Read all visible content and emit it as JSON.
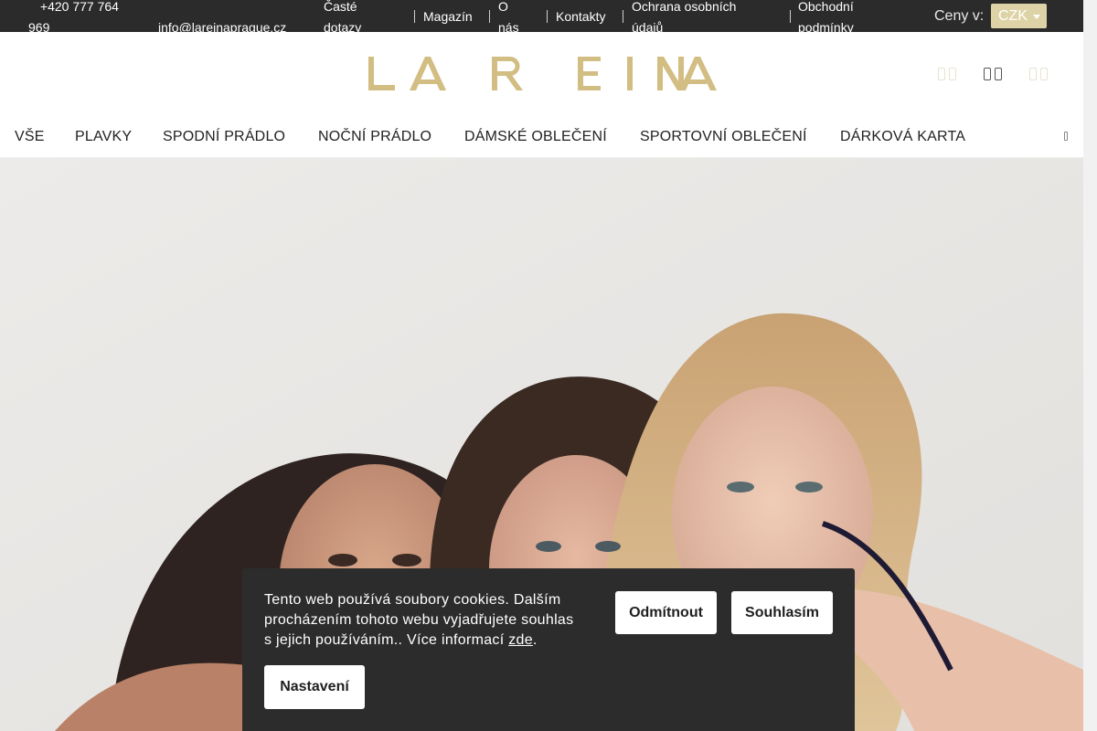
{
  "topbar": {
    "phone": "+420 777 764 969",
    "email": "info@lareinaprague.cz",
    "links": [
      "Časté dotazy",
      "Magazín",
      "O nás",
      "Kontakty",
      "Ochrana osobních údajů",
      "Obchodní podmínky"
    ],
    "prices_label": "Ceny v:",
    "currency": "CZK",
    "icons": {
      "phone": "phone-icon",
      "email": "envelope-icon"
    }
  },
  "header": {
    "logo_text": "LA REINA",
    "icons": [
      "user-icon",
      "search-icon",
      "cart-icon"
    ]
  },
  "nav": {
    "items": [
      "VŠE",
      "PLAVKY",
      "SPODNÍ PRÁDLO",
      "NOČNÍ PRÁDLO",
      "DÁMSKÉ OBLEČENÍ",
      "SPORTOVNÍ OBLEČENÍ",
      "DÁRKOVÁ KARTA"
    ],
    "more_icon": "menu-more-icon"
  },
  "cookie": {
    "message": "Tento web používá soubory cookies. Dalším procházením tohoto webu vyjadřujete souhlas s jejich používáním.. Více informací ",
    "link_text": "zde",
    "after_link": ".",
    "reject_label": "Odmítnout",
    "accept_label": "Souhlasím",
    "settings_label": "Nastavení"
  },
  "colors": {
    "topbar_bg": "#2b2b2b",
    "brand_gold": "#d2bd82",
    "currency_bg": "#ded3a6",
    "cookie_bg": "#2c2c2c"
  }
}
